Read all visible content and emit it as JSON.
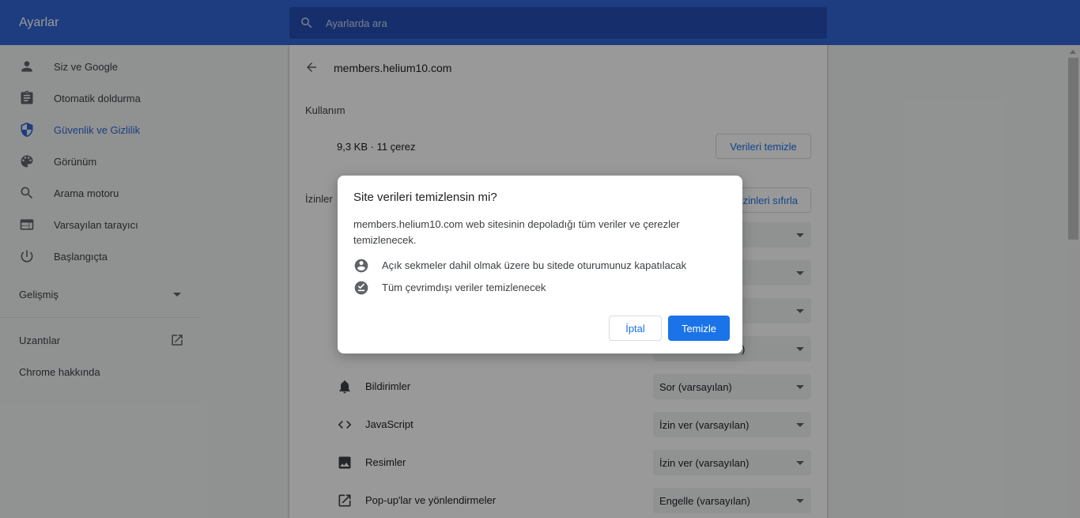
{
  "header": {
    "title": "Ayarlar",
    "search_placeholder": "Ayarlarda ara"
  },
  "sidebar": {
    "items": [
      {
        "label": "Siz ve Google",
        "icon": "person-icon"
      },
      {
        "label": "Otomatik doldurma",
        "icon": "clipboard-icon"
      },
      {
        "label": "Güvenlik ve Gizlilik",
        "icon": "shield-icon",
        "active": true
      },
      {
        "label": "Görünüm",
        "icon": "palette-icon"
      },
      {
        "label": "Arama motoru",
        "icon": "search-icon"
      },
      {
        "label": "Varsayılan tarayıcı",
        "icon": "browser-icon"
      },
      {
        "label": "Başlangıçta",
        "icon": "power-icon"
      }
    ],
    "advanced": "Gelişmiş",
    "extensions": "Uzantılar",
    "about": "Chrome hakkında"
  },
  "main": {
    "site": "members.helium10.com",
    "usage_heading": "Kullanım",
    "usage_value": "9,3 KB · 11 çerez",
    "clear_button": "Verileri temizle",
    "permissions_heading": "İzinler",
    "reset_button": "İzinleri sıfırla",
    "permissions": [
      {
        "label": "Bildirimler",
        "value": "Sor (varsayılan)",
        "icon": "bell-icon"
      },
      {
        "label": "JavaScript",
        "value": "İzin ver (varsayılan)",
        "icon": "code-icon"
      },
      {
        "label": "Resimler",
        "value": "İzin ver (varsayılan)",
        "icon": "image-icon"
      },
      {
        "label": "Pop-up'lar ve yönlendirmeler",
        "value": "Engelle (varsayılan)",
        "icon": "open-in-new-icon"
      }
    ],
    "hidden_select_partial": ")"
  },
  "dialog": {
    "title": "Site verileri temizlensin mi?",
    "body": "members.helium10.com web sitesinin depoladığı tüm veriler ve çerezler temizlenecek.",
    "items": [
      {
        "text": "Açık sekmeler dahil olmak üzere bu sitede oturumunuz kapatılacak",
        "icon": "account-circle-icon"
      },
      {
        "text": "Tüm çevrimdışı veriler temizlenecek",
        "icon": "offline-check-icon"
      }
    ],
    "cancel": "İptal",
    "confirm": "Temizle"
  },
  "colors": {
    "header": "#3367d6",
    "accent": "#1a73e8",
    "active_nav": "#3367d6"
  }
}
